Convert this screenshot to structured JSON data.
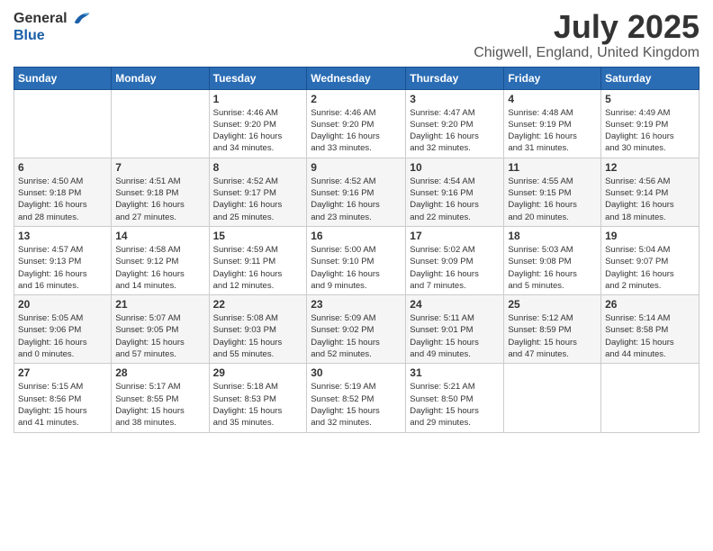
{
  "logo": {
    "general": "General",
    "blue": "Blue"
  },
  "title": "July 2025",
  "subtitle": "Chigwell, England, United Kingdom",
  "days_of_week": [
    "Sunday",
    "Monday",
    "Tuesday",
    "Wednesday",
    "Thursday",
    "Friday",
    "Saturday"
  ],
  "weeks": [
    [
      {
        "day": "",
        "info": ""
      },
      {
        "day": "",
        "info": ""
      },
      {
        "day": "1",
        "info": "Sunrise: 4:46 AM\nSunset: 9:20 PM\nDaylight: 16 hours\nand 34 minutes."
      },
      {
        "day": "2",
        "info": "Sunrise: 4:46 AM\nSunset: 9:20 PM\nDaylight: 16 hours\nand 33 minutes."
      },
      {
        "day": "3",
        "info": "Sunrise: 4:47 AM\nSunset: 9:20 PM\nDaylight: 16 hours\nand 32 minutes."
      },
      {
        "day": "4",
        "info": "Sunrise: 4:48 AM\nSunset: 9:19 PM\nDaylight: 16 hours\nand 31 minutes."
      },
      {
        "day": "5",
        "info": "Sunrise: 4:49 AM\nSunset: 9:19 PM\nDaylight: 16 hours\nand 30 minutes."
      }
    ],
    [
      {
        "day": "6",
        "info": "Sunrise: 4:50 AM\nSunset: 9:18 PM\nDaylight: 16 hours\nand 28 minutes."
      },
      {
        "day": "7",
        "info": "Sunrise: 4:51 AM\nSunset: 9:18 PM\nDaylight: 16 hours\nand 27 minutes."
      },
      {
        "day": "8",
        "info": "Sunrise: 4:52 AM\nSunset: 9:17 PM\nDaylight: 16 hours\nand 25 minutes."
      },
      {
        "day": "9",
        "info": "Sunrise: 4:52 AM\nSunset: 9:16 PM\nDaylight: 16 hours\nand 23 minutes."
      },
      {
        "day": "10",
        "info": "Sunrise: 4:54 AM\nSunset: 9:16 PM\nDaylight: 16 hours\nand 22 minutes."
      },
      {
        "day": "11",
        "info": "Sunrise: 4:55 AM\nSunset: 9:15 PM\nDaylight: 16 hours\nand 20 minutes."
      },
      {
        "day": "12",
        "info": "Sunrise: 4:56 AM\nSunset: 9:14 PM\nDaylight: 16 hours\nand 18 minutes."
      }
    ],
    [
      {
        "day": "13",
        "info": "Sunrise: 4:57 AM\nSunset: 9:13 PM\nDaylight: 16 hours\nand 16 minutes."
      },
      {
        "day": "14",
        "info": "Sunrise: 4:58 AM\nSunset: 9:12 PM\nDaylight: 16 hours\nand 14 minutes."
      },
      {
        "day": "15",
        "info": "Sunrise: 4:59 AM\nSunset: 9:11 PM\nDaylight: 16 hours\nand 12 minutes."
      },
      {
        "day": "16",
        "info": "Sunrise: 5:00 AM\nSunset: 9:10 PM\nDaylight: 16 hours\nand 9 minutes."
      },
      {
        "day": "17",
        "info": "Sunrise: 5:02 AM\nSunset: 9:09 PM\nDaylight: 16 hours\nand 7 minutes."
      },
      {
        "day": "18",
        "info": "Sunrise: 5:03 AM\nSunset: 9:08 PM\nDaylight: 16 hours\nand 5 minutes."
      },
      {
        "day": "19",
        "info": "Sunrise: 5:04 AM\nSunset: 9:07 PM\nDaylight: 16 hours\nand 2 minutes."
      }
    ],
    [
      {
        "day": "20",
        "info": "Sunrise: 5:05 AM\nSunset: 9:06 PM\nDaylight: 16 hours\nand 0 minutes."
      },
      {
        "day": "21",
        "info": "Sunrise: 5:07 AM\nSunset: 9:05 PM\nDaylight: 15 hours\nand 57 minutes."
      },
      {
        "day": "22",
        "info": "Sunrise: 5:08 AM\nSunset: 9:03 PM\nDaylight: 15 hours\nand 55 minutes."
      },
      {
        "day": "23",
        "info": "Sunrise: 5:09 AM\nSunset: 9:02 PM\nDaylight: 15 hours\nand 52 minutes."
      },
      {
        "day": "24",
        "info": "Sunrise: 5:11 AM\nSunset: 9:01 PM\nDaylight: 15 hours\nand 49 minutes."
      },
      {
        "day": "25",
        "info": "Sunrise: 5:12 AM\nSunset: 8:59 PM\nDaylight: 15 hours\nand 47 minutes."
      },
      {
        "day": "26",
        "info": "Sunrise: 5:14 AM\nSunset: 8:58 PM\nDaylight: 15 hours\nand 44 minutes."
      }
    ],
    [
      {
        "day": "27",
        "info": "Sunrise: 5:15 AM\nSunset: 8:56 PM\nDaylight: 15 hours\nand 41 minutes."
      },
      {
        "day": "28",
        "info": "Sunrise: 5:17 AM\nSunset: 8:55 PM\nDaylight: 15 hours\nand 38 minutes."
      },
      {
        "day": "29",
        "info": "Sunrise: 5:18 AM\nSunset: 8:53 PM\nDaylight: 15 hours\nand 35 minutes."
      },
      {
        "day": "30",
        "info": "Sunrise: 5:19 AM\nSunset: 8:52 PM\nDaylight: 15 hours\nand 32 minutes."
      },
      {
        "day": "31",
        "info": "Sunrise: 5:21 AM\nSunset: 8:50 PM\nDaylight: 15 hours\nand 29 minutes."
      },
      {
        "day": "",
        "info": ""
      },
      {
        "day": "",
        "info": ""
      }
    ]
  ]
}
